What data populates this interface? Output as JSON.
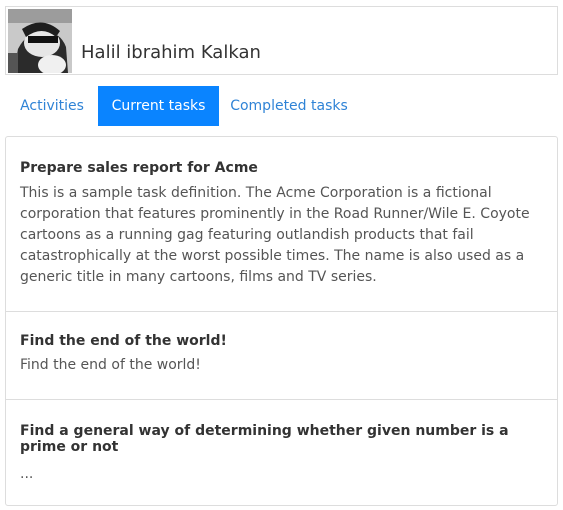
{
  "profile": {
    "name": "Halil ibrahim Kalkan"
  },
  "tabs": [
    {
      "label": "Activities",
      "active": false
    },
    {
      "label": "Current tasks",
      "active": true
    },
    {
      "label": "Completed tasks",
      "active": false
    }
  ],
  "tasks": [
    {
      "title": "Prepare sales report for Acme",
      "description": "This is a sample task definition. The Acme Corporation is a fictional corporation that features prominently in the Road Runner/Wile E. Coyote cartoons as a running gag featuring outlandish products that fail catastrophically at the worst possible times. The name is also used as a generic title in many cartoons, films and TV series."
    },
    {
      "title": "Find the end of the world!",
      "description": "Find the end of the world!"
    },
    {
      "title": "Find a general way of determining whether given number is a prime or not",
      "description": "..."
    }
  ],
  "colors": {
    "accent": "#0a84ff",
    "link": "#2f83d6",
    "border": "#dddddd"
  }
}
